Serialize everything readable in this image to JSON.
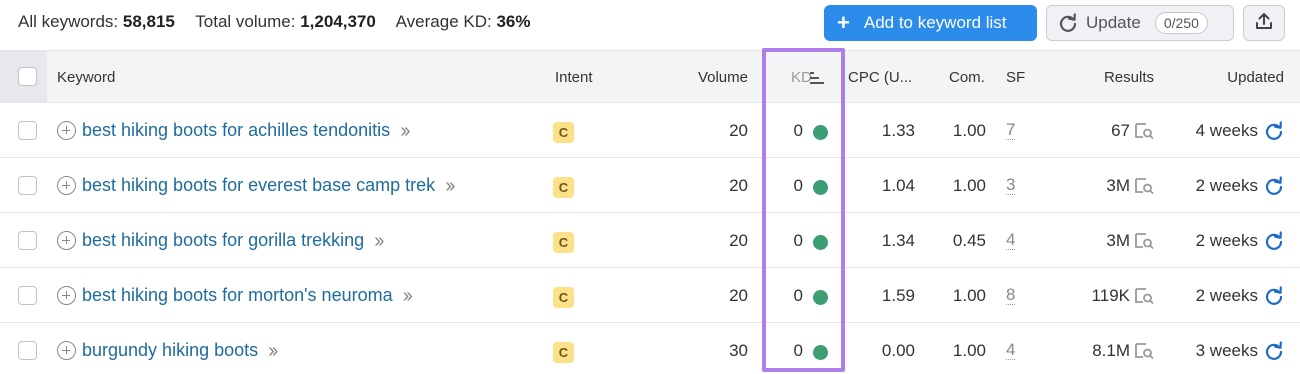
{
  "summary": {
    "all_keywords_label": "All keywords:",
    "all_keywords_value": "58,815",
    "total_volume_label": "Total volume:",
    "total_volume_value": "1,204,370",
    "avg_kd_label": "Average KD:",
    "avg_kd_value": "36%"
  },
  "toolbar": {
    "add_label": "Add to keyword list",
    "add_icon": "plus-icon",
    "update_label": "Update",
    "update_count": "0/250",
    "update_icon": "refresh-icon",
    "export_icon": "export-icon"
  },
  "columns": {
    "keyword": "Keyword",
    "intent": "Intent",
    "volume": "Volume",
    "kd": "KD",
    "cpc": "CPC (U...",
    "com": "Com.",
    "sf": "SF",
    "results": "Results",
    "updated": "Updated"
  },
  "rows": [
    {
      "keyword": "best hiking boots for achilles tendonitis",
      "intent": "C",
      "volume": "20",
      "kd": "0",
      "cpc": "1.33",
      "com": "1.00",
      "sf": "7",
      "results": "67",
      "updated": "4 weeks"
    },
    {
      "keyword": "best hiking boots for everest base camp trek",
      "intent": "C",
      "volume": "20",
      "kd": "0",
      "cpc": "1.04",
      "com": "1.00",
      "sf": "3",
      "results": "3M",
      "updated": "2 weeks"
    },
    {
      "keyword": "best hiking boots for gorilla trekking",
      "intent": "C",
      "volume": "20",
      "kd": "0",
      "cpc": "1.34",
      "com": "0.45",
      "sf": "4",
      "results": "3M",
      "updated": "2 weeks"
    },
    {
      "keyword": "best hiking boots for morton's neuroma",
      "intent": "C",
      "volume": "20",
      "kd": "0",
      "cpc": "1.59",
      "com": "1.00",
      "sf": "8",
      "results": "119K",
      "updated": "2 weeks"
    },
    {
      "keyword": "burgundy hiking boots",
      "intent": "C",
      "volume": "30",
      "kd": "0",
      "cpc": "0.00",
      "com": "1.00",
      "sf": "4",
      "results": "8.1M",
      "updated": "3 weeks"
    }
  ],
  "colors": {
    "accent": "#2b8ceb",
    "link": "#1e6c9e",
    "kd_easy": "#3d9e74",
    "intent_commercial": "#fde18a",
    "highlight": "#b07ee8"
  }
}
